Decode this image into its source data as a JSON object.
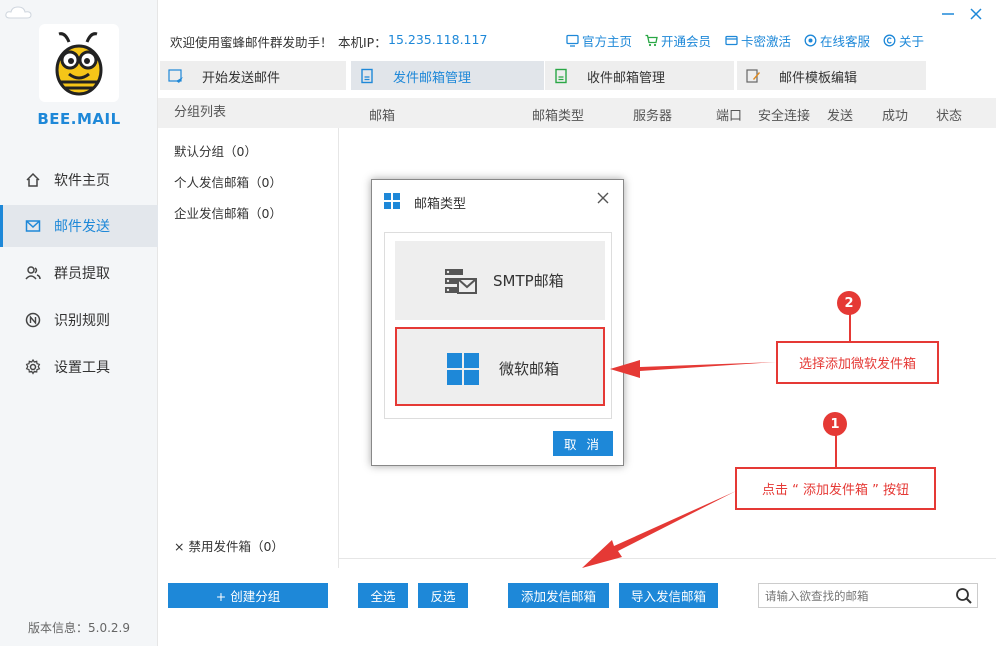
{
  "app": {
    "brand": "BEE.MAIL",
    "version": "版本信息：5.0.2.9"
  },
  "sidebar": {
    "items": [
      {
        "label": "软件主页",
        "icon": "home-icon"
      },
      {
        "label": "邮件发送",
        "icon": "mail-icon",
        "active": true
      },
      {
        "label": "群员提取",
        "icon": "users-icon"
      },
      {
        "label": "识别规则",
        "icon": "rule-icon"
      },
      {
        "label": "设置工具",
        "icon": "gear-icon"
      }
    ]
  },
  "topbar": {
    "welcome": "欢迎使用蜜蜂邮件群发助手！",
    "ip_label": "本机IP：",
    "ip_value": "15.235.118.117",
    "links": [
      "官方主页",
      "开通会员",
      "卡密激活",
      "在线客服",
      "关于"
    ]
  },
  "tabs": [
    "开始发送邮件",
    "发件邮箱管理",
    "收件邮箱管理",
    "邮件模板编辑"
  ],
  "groups": {
    "header": "分组列表",
    "items": [
      "默认分组（0）",
      "个人发信邮箱（0）",
      "企业发信邮箱（0）"
    ],
    "disabled": "× 禁用发件箱（0）",
    "create_button": "+ 创建分组"
  },
  "table": {
    "columns": [
      "邮箱",
      "邮箱类型",
      "服务器",
      "端口",
      "安全连接",
      "发送",
      "成功",
      "状态"
    ]
  },
  "actions": {
    "select_all": "全选",
    "invert": "反选",
    "add_sender": "添加发信邮箱",
    "import_sender": "导入发信邮箱",
    "search_placeholder": "请输入欲查找的邮箱"
  },
  "modal": {
    "title": "邮箱类型",
    "smtp_option": "SMTP邮箱",
    "ms_option": "微软邮箱",
    "cancel": "取 消"
  },
  "annotations": {
    "step1_number": "1",
    "step1_text": "点击 “ 添加发件箱 ” 按钮",
    "step2_number": "2",
    "step2_text": "选择添加微软发件箱"
  },
  "colors": {
    "accent": "#1e88d8",
    "annotation": "#e53935"
  }
}
